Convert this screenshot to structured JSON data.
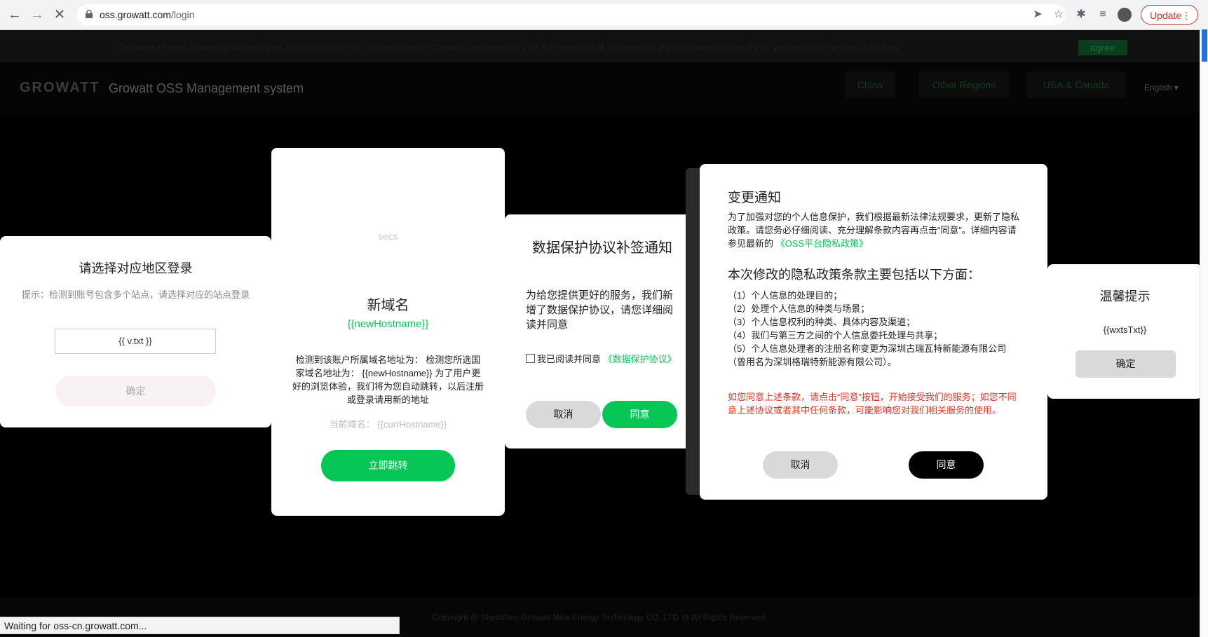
{
  "browser": {
    "url_host": "oss.growatt.com",
    "url_path": "/login",
    "update_label": "Update",
    "status_text": "Waiting for oss-cn.growatt.com..."
  },
  "page": {
    "cookie_text": "Our website uses cookies provided by us and some from the Google browser. Cookies are necessary for the operation of the website. If you continue to use them, you agree to the use of cookies",
    "cookie_agree": "agree",
    "logo": "GROWATT",
    "subtitle": "Growatt OSS Management system",
    "regions": [
      "China",
      "Other Regions",
      "USA & Canada"
    ],
    "language": "English",
    "footer": "Copyright @ Shenzhen Growatt New Energy Technology CO.,LTD @ All Rights Reserved"
  },
  "dialog_region": {
    "title": "请选择对应地区登录",
    "hint": "提示：检测到账号包含多个站点，请选择对应的站点登录",
    "select_value": "{{ v.txt }}",
    "confirm": "确定"
  },
  "dialog_domain": {
    "secs": "secs",
    "title": "新域名",
    "new_host": "{{newHostname}}",
    "body": "检测到该账户所属域名地址为： 检测您所选国家域名地址为： {{newHostname}} 为了用户更好的浏览体验，我们将为您自动跳转，以后注册或登录请用新的地址",
    "current_label": "当前域名：",
    "current_value": "{{currHostname}}",
    "jump": "立即跳转"
  },
  "dialog_data": {
    "title": "数据保护协议补签通知",
    "body": "为给您提供更好的服务，我们新增了数据保护协议，请您详细阅读并同意",
    "checkbox_label": "我已阅读并同意",
    "link": "《数据保护协议》",
    "cancel": "取消",
    "agree": "同意"
  },
  "dialog_change": {
    "title": "变更通知",
    "intro": "为了加强对您的个人信息保护，我们根据最新法律法规要求，更新了隐私政策。请您务必仔细阅读、充分理解条款内容再点击“同意”。详细内容请参见最新的",
    "link": "《OSS平台隐私政策》",
    "heading": "本次修改的隐私政策条款主要包括以下方面：",
    "items": [
      "（1）个人信息的处理目的；",
      "（2）处理个人信息的种类与场景；",
      "（3）个人信息权利的种类、具体内容及渠道；",
      "（4）我们与第三方之间的个人信息委托处理与共享；",
      "（5）个人信息处理者的注册名称变更为深圳古瑞瓦特新能源有限公司（曾用名为深圳格瑞特新能源有限公司）。"
    ],
    "warning": "如您同意上述条款，请点击“同意”按钮，开始接受我们的服务；如您不同意上述协议或者其中任何条款，可能影响您对我们相关服务的使用。",
    "cancel": "取消",
    "agree": "同意"
  },
  "dialog_tip": {
    "title": "温馨提示",
    "body": "{{wxtsTxt}}",
    "confirm": "确定"
  },
  "colors": {
    "green": "#06c655",
    "red": "#e8321a",
    "black_button": "#000000"
  }
}
